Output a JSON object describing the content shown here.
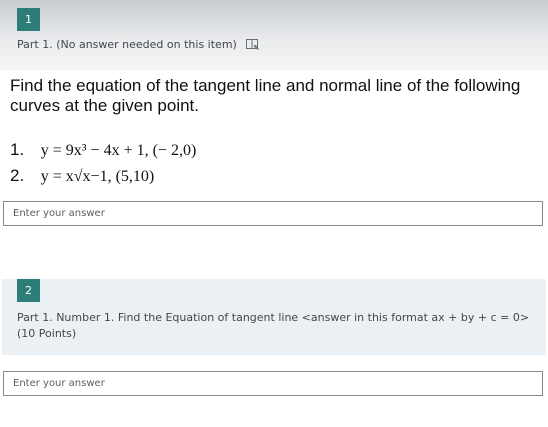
{
  "question1": {
    "number": "1",
    "title": "Part 1. (No answer needed on this item)",
    "icon": "immersive-reader-icon",
    "prompt": "Find the equation of the tangent line and normal line of the following curves at the given point.",
    "items": [
      {
        "label": "1.",
        "expression": "y = 9x³ − 4x + 1, (− 2,0)"
      },
      {
        "label": "2.",
        "expression": "y = x√x−1,  (5,10)"
      }
    ],
    "answer_placeholder": "Enter your answer"
  },
  "question2": {
    "number": "2",
    "title": "Part 1. Number 1. Find the Equation of tangent line <answer in this format ax + by + c = 0> (10 Points)",
    "answer_placeholder": "Enter your answer"
  },
  "colors": {
    "accent": "#2d7d79",
    "q2_background": "#eaf0f3"
  }
}
